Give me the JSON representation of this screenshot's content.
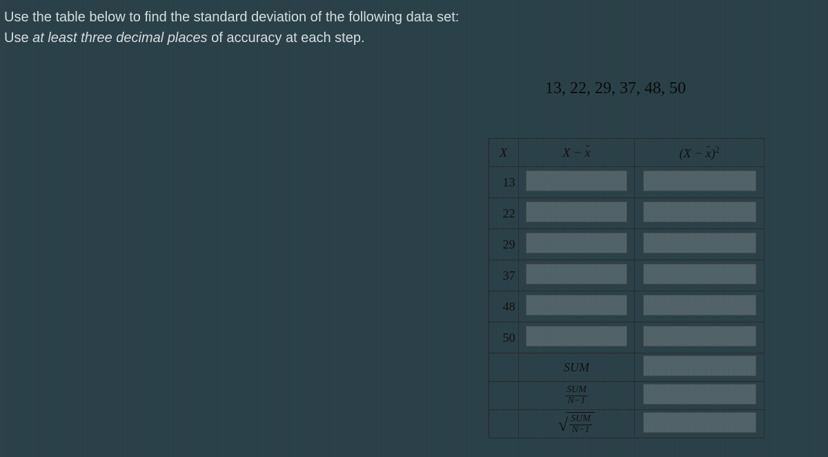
{
  "instructions": {
    "line1": "Use the table below to find the standard deviation of the following data set:",
    "line2_prefix": "Use ",
    "line2_em": "at least three decimal places",
    "line2_suffix": " of accuracy at each step."
  },
  "dataset": "13, 22, 29, 37, 48, 50",
  "headers": {
    "col1": "X",
    "col2": "X − x̄",
    "col3": "(X − x̄)²"
  },
  "rows": [
    "13",
    "22",
    "29",
    "37",
    "48",
    "50"
  ],
  "sumrows": {
    "sum_label": "SUM",
    "sum_frac_num": "SUM",
    "sum_frac_den": "N−1",
    "sqrt_frac_num": "SUM",
    "sqrt_frac_den": "N−1"
  }
}
